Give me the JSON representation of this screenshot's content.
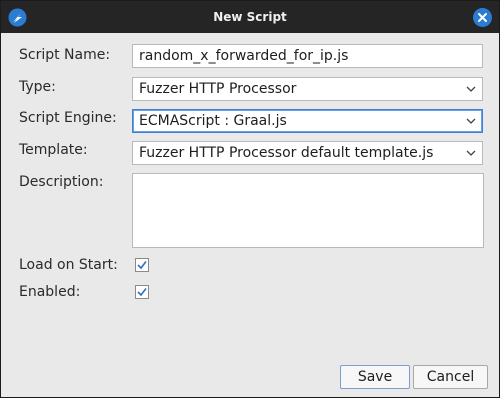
{
  "window": {
    "title": "New Script"
  },
  "form": {
    "name_label": "Script Name:",
    "name_value": "random_x_forwarded_for_ip.js",
    "type_label": "Type:",
    "type_value": "Fuzzer HTTP Processor",
    "engine_label": "Script Engine:",
    "engine_value": "ECMAScript : Graal.js",
    "template_label": "Template:",
    "template_value": "Fuzzer HTTP Processor default template.js",
    "description_label": "Description:",
    "description_value": "",
    "load_on_start_label": "Load on Start:",
    "load_on_start_checked": true,
    "enabled_label": "Enabled:",
    "enabled_checked": true
  },
  "buttons": {
    "save_label": "Save",
    "cancel_label": "Cancel"
  },
  "colors": {
    "accent": "#2b7cd3",
    "titlebar": "#252525",
    "dialog_bg": "#e9e9e9"
  },
  "icons": {
    "app": "zap-app-icon",
    "close": "close-icon",
    "dropdown": "chevron-down-icon",
    "check": "check-icon"
  }
}
